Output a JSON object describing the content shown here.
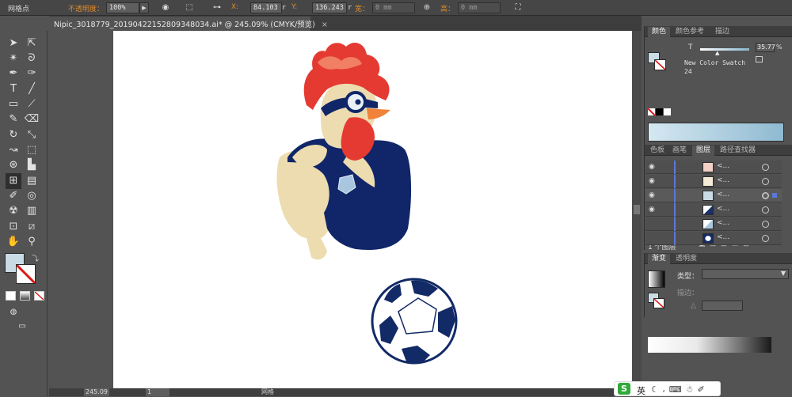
{
  "control_bar": {
    "selection_label": "网格点",
    "opacity_label": "不透明度：",
    "opacity_value": "100%",
    "x_label": "X:",
    "x_value": "84.103 r",
    "y_label": "Y:",
    "y_value": "136.243 r",
    "w_label": "宽：",
    "w_value": "0 mm",
    "h_label": "高：",
    "h_value": "0 mm"
  },
  "document_tab": {
    "title": "Nipic_3018779_20190422152809348034.ai* @ 245.09% (CMYK/预览)",
    "close": "×"
  },
  "color_panel": {
    "tabs": [
      "颜色",
      "颜色参考",
      "描边"
    ],
    "channel": "T",
    "tint_value": "35.77",
    "tint_unit": "%",
    "swatch_name": "New Color Swatch",
    "swatch_number": "24",
    "colors": {
      "fill": "#c9dce6",
      "gradient_from": "#d5e8f2",
      "gradient_to": "#8fbad1",
      "slider": "#8ab6ce"
    }
  },
  "layers_panel": {
    "tabs": [
      "色板",
      "画笔",
      "图层",
      "路径查找器"
    ],
    "rows": [
      {
        "name": "<...",
        "thumb_color": "#e8453c"
      },
      {
        "name": "<...",
        "thumb_color": "#e8dcb0"
      },
      {
        "name": "<...",
        "thumb_color": "#b7cde0"
      },
      {
        "name": "<...",
        "thumb_color": "#1c2f66"
      },
      {
        "name": "<...",
        "thumb_color": "#a9c8df"
      },
      {
        "name": "<...",
        "thumb_color": "#152a63"
      }
    ],
    "footer": "1 个图层"
  },
  "gradient_panel": {
    "tabs": [
      "渐变",
      "透明度"
    ],
    "type_label": "类型：",
    "stroke_label": "描边：",
    "angle_label": "△"
  },
  "status_bar": {
    "zoom": "245.09",
    "page": "1",
    "tool_name": "网格"
  },
  "tray": {
    "ime": "英"
  },
  "artwork": {
    "colors": {
      "comb": "#e53a31",
      "comb_light": "#f07f64",
      "skin": "#ecdcaf",
      "shirt": "#102668",
      "beak": "#f0823a",
      "ball_navy": "#122a66"
    }
  }
}
